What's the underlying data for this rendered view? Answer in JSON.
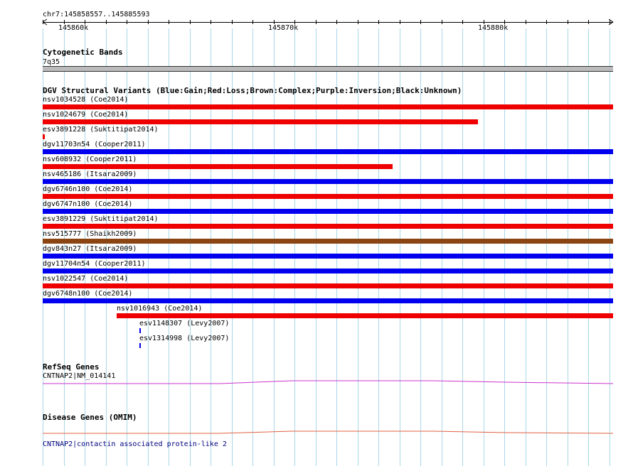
{
  "locus": "chr7:145858557..145885593",
  "ruler": {
    "ticks": [
      {
        "label": "145860k"
      },
      {
        "label": "145870k"
      },
      {
        "label": "145880k"
      }
    ]
  },
  "cyto": {
    "title": "Cytogenetic Bands",
    "band_label": "7q35",
    "band_color": "#bbbbbb"
  },
  "dgv": {
    "title": "DGV Structural Variants (Blue:Gain;Red:Loss;Brown:Complex;Purple:Inversion;Black:Unknown)",
    "colors": {
      "gain": "#0000ee",
      "loss": "#ee0000",
      "complex": "#8b4513"
    },
    "variants": [
      {
        "label": "nsv1034528 (Coe2014)",
        "type": "loss"
      },
      {
        "label": "nsv1024679 (Coe2014)",
        "type": "loss"
      },
      {
        "label": "esv3891228 (Suktitipat2014)",
        "type": "loss"
      },
      {
        "label": "dgv11703n54 (Cooper2011)",
        "type": "gain"
      },
      {
        "label": "nsv608932 (Cooper2011)",
        "type": "loss"
      },
      {
        "label": "nsv465186 (Itsara2009)",
        "type": "gain"
      },
      {
        "label": "dgv6746n100 (Coe2014)",
        "type": "loss"
      },
      {
        "label": "dgv6747n100 (Coe2014)",
        "type": "gain"
      },
      {
        "label": "esv3891229 (Suktitipat2014)",
        "type": "loss"
      },
      {
        "label": "nsv515777 (Shaikh2009)",
        "type": "complex"
      },
      {
        "label": "dgv843n27 (Itsara2009)",
        "type": "gain"
      },
      {
        "label": "dgv11704n54 (Cooper2011)",
        "type": "gain"
      },
      {
        "label": "nsv1022547 (Coe2014)",
        "type": "loss"
      },
      {
        "label": "dgv6748n100 (Coe2014)",
        "type": "gain"
      },
      {
        "label": "nsv1016943 (Coe2014)",
        "type": "loss"
      },
      {
        "label": "esv1148307 (Levy2007)",
        "type": "gain"
      },
      {
        "label": "esv1314998 (Levy2007)",
        "type": "gain"
      }
    ]
  },
  "refseq": {
    "title": "RefSeq Genes",
    "gene_label": "CNTNAP2|NM_014141",
    "color": "#cc33cc"
  },
  "omim": {
    "title": "Disease Genes (OMIM)",
    "gene_label": "CNTNAP2|contactin associated protein-like 2",
    "color": "#e06040"
  }
}
